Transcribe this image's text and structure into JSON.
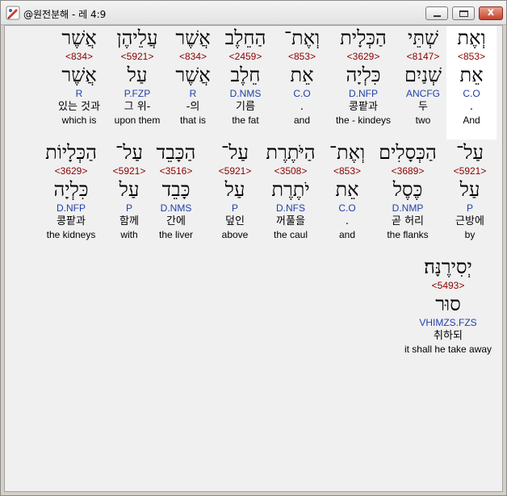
{
  "window": {
    "title": "@원전분해 - 레 4:9",
    "close_glyph": "x"
  },
  "rows": [
    [
      {
        "heb": "וְאֶת",
        "num": "<853>",
        "lemma": "אֵת",
        "parse": "C.O",
        "kor": ".",
        "eng": "And"
      },
      {
        "heb": "שְׁתֵּי",
        "num": "<8147>",
        "lemma": "שְׁנַיִם",
        "parse": "ANCFG",
        "kor": "두",
        "eng": "two"
      },
      {
        "heb": "הַכְּלָית",
        "num": "<3629>",
        "lemma": "כִּלְיָה",
        "parse": "D.NFP",
        "kor": "콩팥과",
        "eng": "the - kindeys"
      },
      {
        "heb": "וְאֶת־",
        "num": "<853>",
        "lemma": "אֵת",
        "parse": "C.O",
        "kor": ".",
        "eng": "and"
      },
      {
        "heb": "הַחֵלֶב",
        "num": "<2459>",
        "lemma": "חֵלֶב",
        "parse": "D.NMS",
        "kor": "기름",
        "eng": "the fat"
      },
      {
        "heb": "אֲשֶׁר",
        "num": "<834>",
        "lemma": "אֲשֶׁר",
        "parse": "R",
        "kor": "-의",
        "eng": "that is"
      },
      {
        "heb": "עֲלֵיהֶן",
        "num": "<5921>",
        "lemma": "עַל",
        "parse": "P.FZP",
        "kor": "그 위-",
        "eng": "upon them"
      },
      {
        "heb": "אֲשֶׁר",
        "num": "<834>",
        "lemma": "אֲשֶׁר",
        "parse": "R",
        "kor": "있는 것과",
        "eng": "which is"
      }
    ],
    [
      {
        "heb": "עַל־",
        "num": "<5921>",
        "lemma": "עַל",
        "parse": "P",
        "kor": "근방에",
        "eng": "by"
      },
      {
        "heb": "הַכְּסָלִים",
        "num": "<3689>",
        "lemma": "כֶּסֶל",
        "parse": "D.NMP",
        "kor": "곧 허리",
        "eng": "the flanks"
      },
      {
        "heb": "וְאֶת־",
        "num": "<853>",
        "lemma": "אֵת",
        "parse": "C.O",
        "kor": ".",
        "eng": "and"
      },
      {
        "heb": "הַיֹּתֶרֶת",
        "num": "<3508>",
        "lemma": "יֹתֶרֶת",
        "parse": "D.NFS",
        "kor": "꺼풀을",
        "eng": "the caul"
      },
      {
        "heb": "עַל־",
        "num": "<5921>",
        "lemma": "עַל",
        "parse": "P",
        "kor": "덮인",
        "eng": "above"
      },
      {
        "heb": "הַכָּבֵד",
        "num": "<3516>",
        "lemma": "כָּבֵד",
        "parse": "D.NMS",
        "kor": "간에",
        "eng": "the liver"
      },
      {
        "heb": "עַל־",
        "num": "<5921>",
        "lemma": "עַל",
        "parse": "P",
        "kor": "함께",
        "eng": "with"
      },
      {
        "heb": "הַכְּלָיוֹת",
        "num": "<3629>",
        "lemma": "כִּלְיָה",
        "parse": "D.NFP",
        "kor": "콩팥과",
        "eng": "the kidneys"
      }
    ],
    [
      {
        "heb": "יְסִירֶנָּה׃",
        "num": "<5493>",
        "lemma": "סוּר",
        "parse": "VHIMZS.FZS",
        "kor": "취하되",
        "eng": "it shall he take away"
      }
    ]
  ]
}
